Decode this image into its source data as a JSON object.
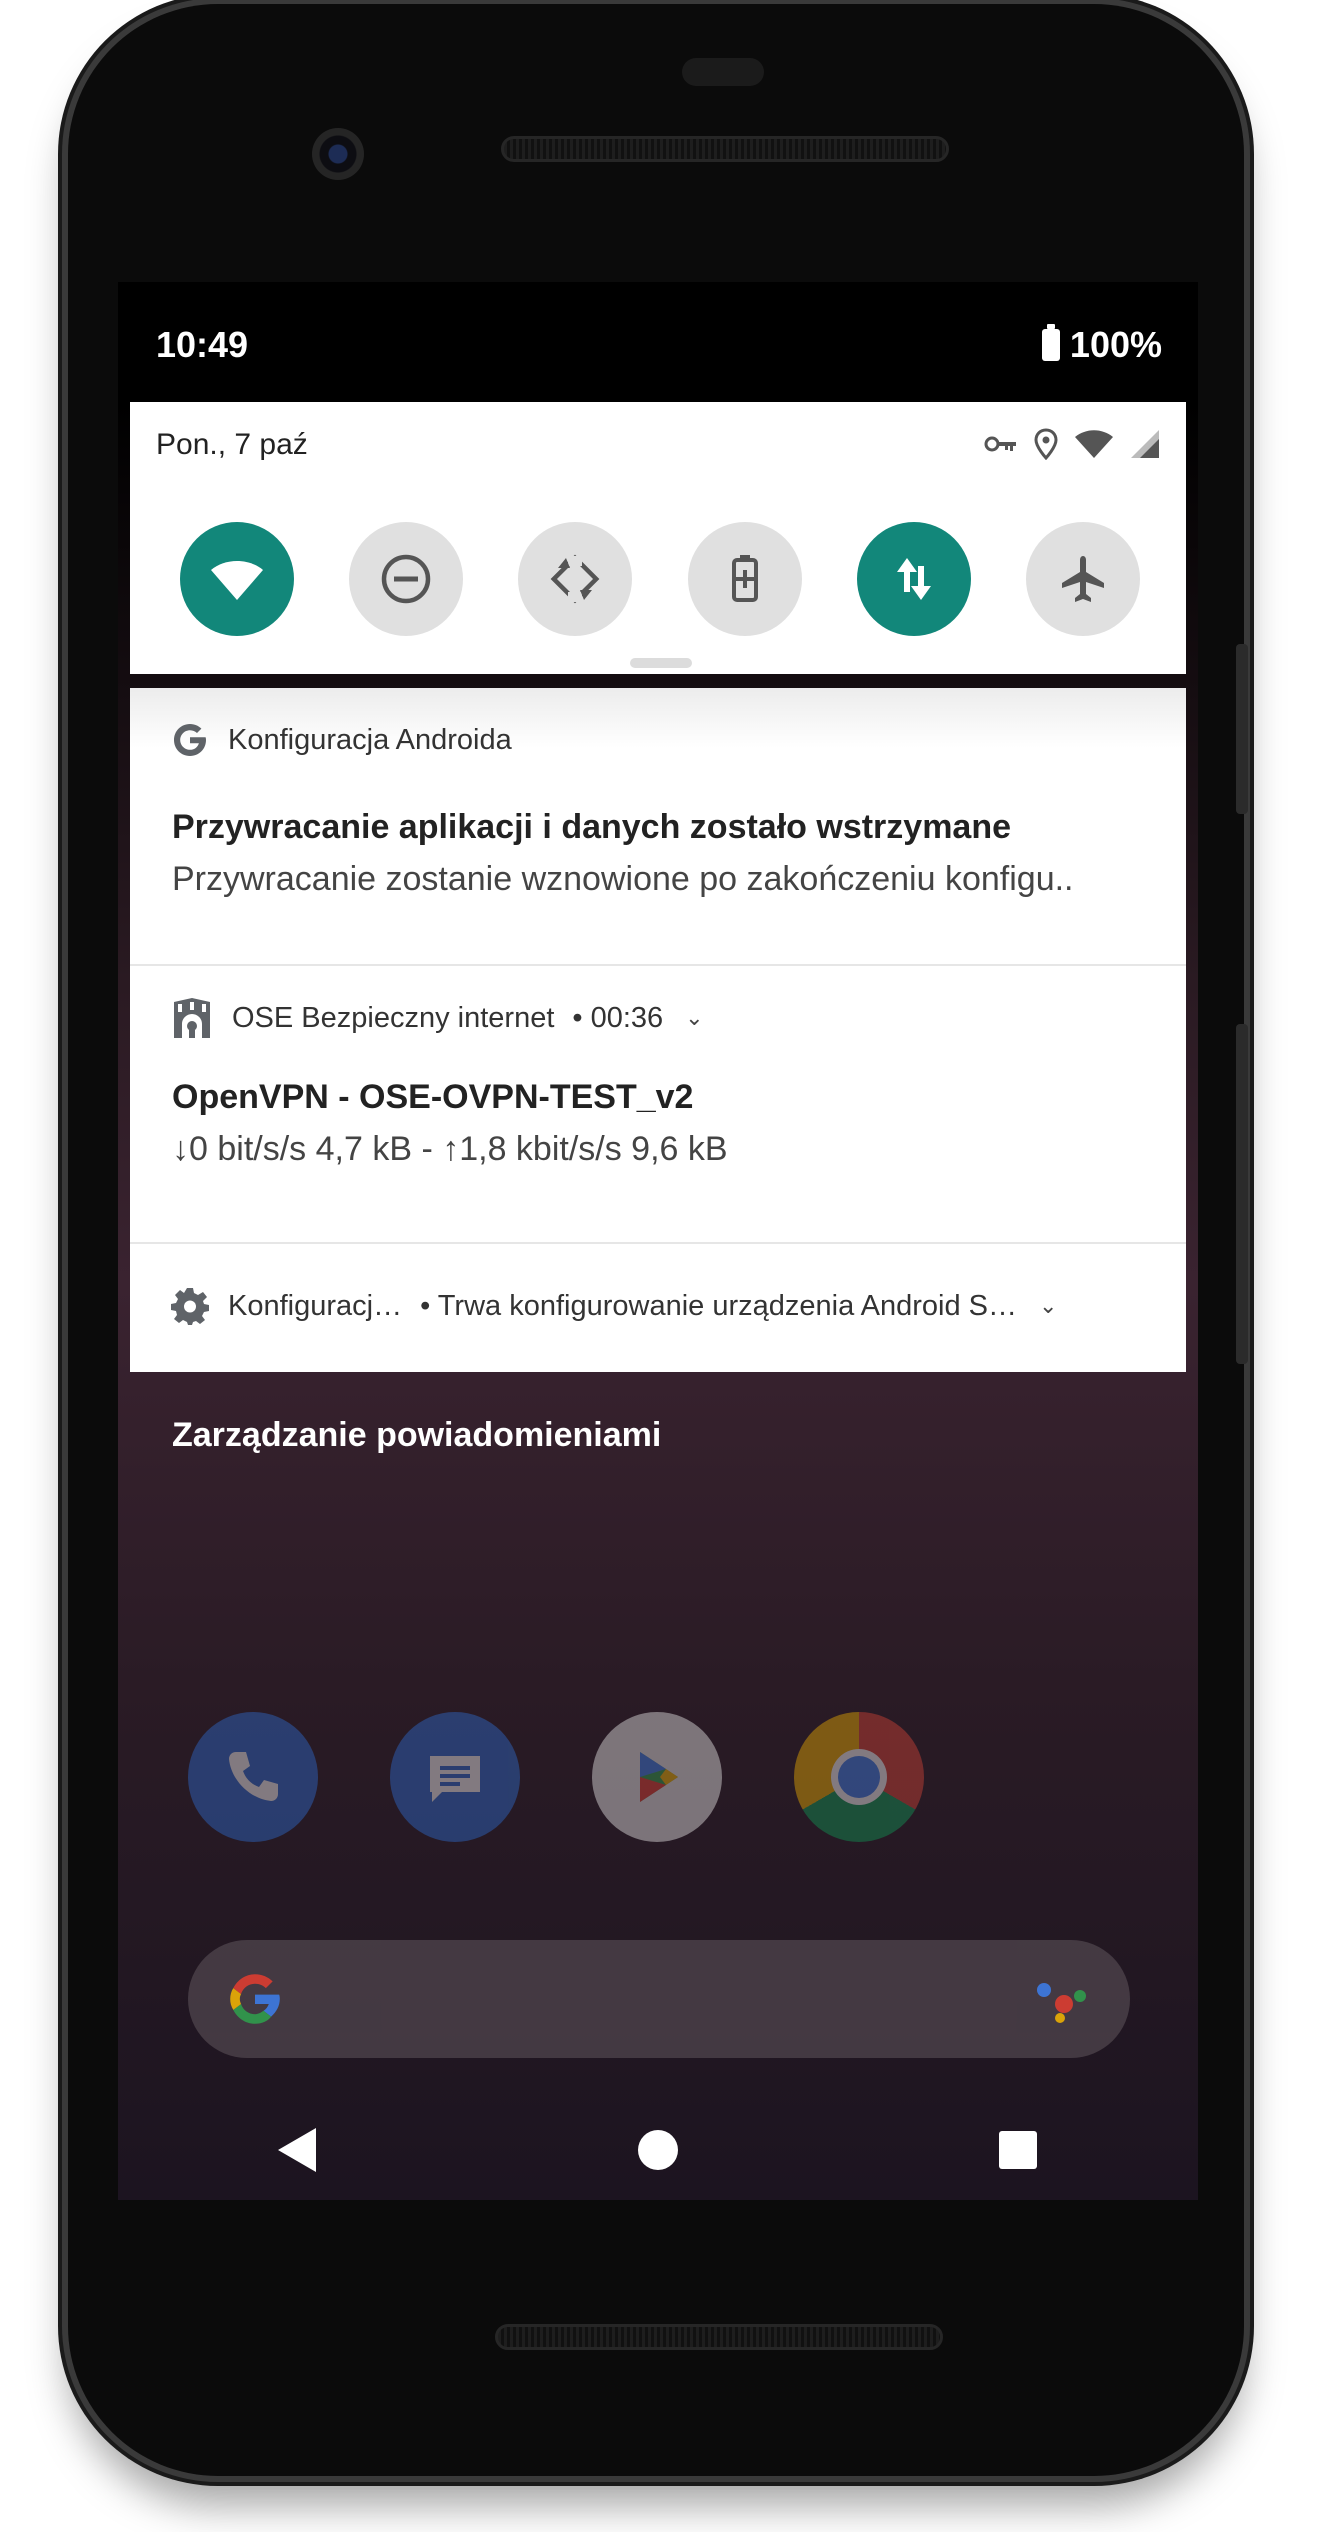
{
  "status_bar": {
    "time": "10:49",
    "battery_percent": "100%"
  },
  "quick_settings": {
    "date": "Pon., 7 paź",
    "status_icons": [
      "vpn-key-icon",
      "location-icon",
      "wifi-icon",
      "cell-signal-icon"
    ],
    "tiles": [
      {
        "name": "wifi-tile",
        "icon": "wifi-icon",
        "on": true
      },
      {
        "name": "do-not-disturb-tile",
        "icon": "do-not-disturb-icon",
        "on": false
      },
      {
        "name": "auto-rotate-tile",
        "icon": "auto-rotate-icon",
        "on": false
      },
      {
        "name": "battery-saver-tile",
        "icon": "battery-saver-icon",
        "on": false
      },
      {
        "name": "mobile-data-tile",
        "icon": "mobile-data-icon",
        "on": true
      },
      {
        "name": "airplane-mode-tile",
        "icon": "airplane-icon",
        "on": false
      }
    ],
    "accent_color": "#12877a"
  },
  "notifications": [
    {
      "app": "Konfiguracja Androida",
      "icon": "google-g-icon",
      "title": "Przywracanie aplikacji i danych zostało wstrzymane",
      "text": "Przywracanie zostanie wznowione po zakończeniu konfigu.."
    },
    {
      "app": "OSE Bezpieczny internet",
      "time": "• 00:36",
      "icon": "ose-shield-icon",
      "title": "OpenVPN - OSE-OVPN-TEST_v2",
      "text": "↓0 bit/s/s 4,7 kB - ↑1,8 kbit/s/s 9,6 kB"
    },
    {
      "app": "Konfiguracj…",
      "summary": "• Trwa konfigurowanie urządzenia Android S…",
      "icon": "gear-icon"
    }
  ],
  "manage_notifications": "Zarządzanie powiadomieniami",
  "home": {
    "dock_apps": [
      "phone-icon",
      "messages-icon",
      "play-store-icon",
      "chrome-icon"
    ],
    "search_bar_icons": [
      "google-g-icon",
      "assistant-icon"
    ]
  },
  "nav_bar": [
    "back-icon",
    "home-icon",
    "recents-icon"
  ]
}
